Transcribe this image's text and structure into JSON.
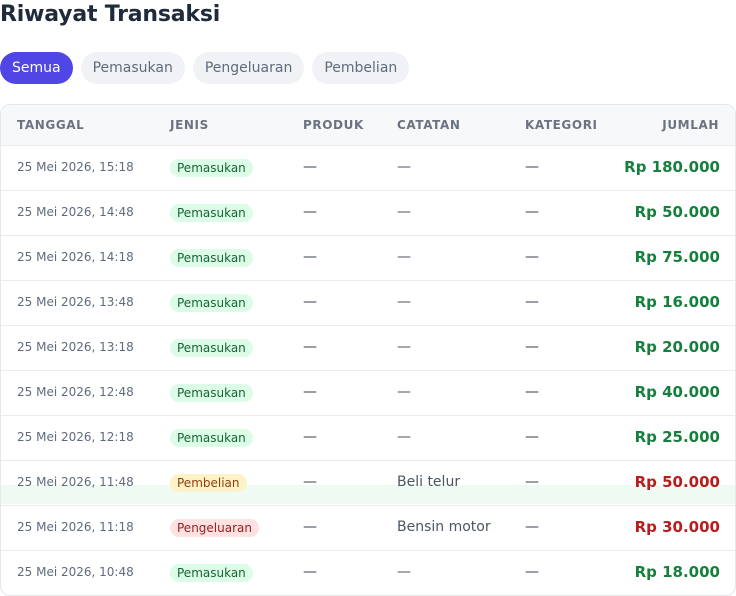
{
  "page": {
    "title": "Riwayat Transaksi"
  },
  "tabs": [
    "Semua",
    "Pemasukan",
    "Pengeluaran",
    "Pembelian"
  ],
  "active_tab": "Semua",
  "table": {
    "headers": {
      "date": "TANGGAL",
      "type": "JENIS",
      "product": "PRODUK",
      "note": "CATATAN",
      "category": "KATEGORI",
      "amount": "JUMLAH"
    },
    "rows": [
      {
        "date": "25 Mei 2026, 15:18",
        "type": "Pemasukan",
        "kind": "masuk",
        "product": "—",
        "note": "—",
        "category": "—",
        "amount": "Rp 180.000"
      },
      {
        "date": "25 Mei 2026, 14:48",
        "type": "Pemasukan",
        "kind": "masuk",
        "product": "—",
        "note": "—",
        "category": "—",
        "amount": "Rp 50.000"
      },
      {
        "date": "25 Mei 2026, 14:18",
        "type": "Pemasukan",
        "kind": "masuk",
        "product": "—",
        "note": "—",
        "category": "—",
        "amount": "Rp 75.000"
      },
      {
        "date": "25 Mei 2026, 13:48",
        "type": "Pemasukan",
        "kind": "masuk",
        "product": "—",
        "note": "—",
        "category": "—",
        "amount": "Rp 16.000"
      },
      {
        "date": "25 Mei 2026, 13:18",
        "type": "Pemasukan",
        "kind": "masuk",
        "product": "—",
        "note": "—",
        "category": "—",
        "amount": "Rp 20.000"
      },
      {
        "date": "25 Mei 2026, 12:48",
        "type": "Pemasukan",
        "kind": "masuk",
        "product": "—",
        "note": "—",
        "category": "—",
        "amount": "Rp 40.000"
      },
      {
        "date": "25 Mei 2026, 12:18",
        "type": "Pemasukan",
        "kind": "masuk",
        "product": "—",
        "note": "—",
        "category": "—",
        "amount": "Rp 25.000"
      },
      {
        "date": "25 Mei 2026, 11:48",
        "type": "Pembelian",
        "kind": "beli",
        "product": "—",
        "note": "Beli telur",
        "category": "—",
        "amount": "Rp 50.000"
      },
      {
        "date": "25 Mei 2026, 11:18",
        "type": "Pengeluaran",
        "kind": "keluar",
        "product": "—",
        "note": "Bensin motor",
        "category": "—",
        "amount": "Rp 30.000"
      },
      {
        "date": "25 Mei 2026, 10:48",
        "type": "Pemasukan",
        "kind": "masuk",
        "product": "—",
        "note": "—",
        "category": "—",
        "amount": "Rp 18.000"
      }
    ]
  },
  "colors": {
    "accent": "#4f46e5",
    "income": "#15803d",
    "expense": "#b91c1c"
  }
}
